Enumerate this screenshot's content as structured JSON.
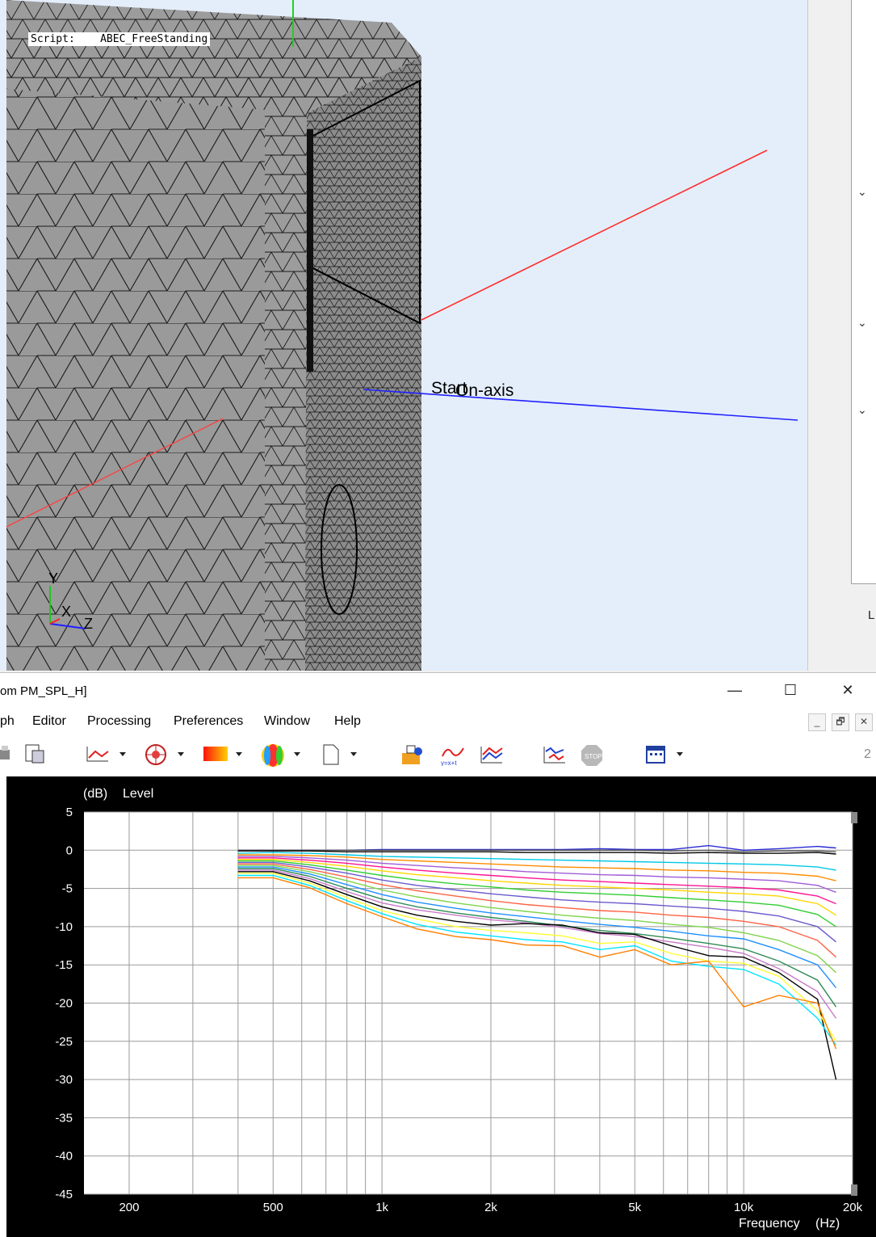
{
  "viewport": {
    "script_label": "Script:    ABEC_FreeStanding",
    "observation_label": "Start",
    "observation_label_overlap": "On-axis",
    "axis_y": "Y",
    "axis_x": "X",
    "axis_z": "Z"
  },
  "side_panel": {
    "letter": "L"
  },
  "window": {
    "title": "om PM_SPL_H]",
    "minimize": "—",
    "maximize": "☐",
    "close": "✕"
  },
  "menu": [
    "ph",
    "Editor",
    "Processing",
    "Preferences",
    "Window",
    "Help"
  ],
  "mdi_buttons": [
    "_",
    "🗗",
    "✕"
  ],
  "toolbar_right_label": "2",
  "toolbar": {
    "icons": [
      "print-icon",
      "paste-icon",
      "line-chart-icon",
      "polar-chart-icon",
      "color-map-icon",
      "balloon-icon",
      "new-page-icon",
      "open-folder-icon",
      "function-icon",
      "graph-icon",
      "graph-stack-icon",
      "stop-icon",
      "calendar-icon"
    ]
  },
  "chart_data": {
    "type": "line",
    "ylabel": "Level",
    "yunit": "(dB)",
    "xlabel": "Frequency",
    "xunit": "(Hz)",
    "xscale": "log",
    "xlim": [
      150,
      20000
    ],
    "ylim": [
      -45,
      5
    ],
    "x_ticks": [
      "200",
      "500",
      "1k",
      "2k",
      "5k",
      "10k",
      "20k"
    ],
    "y_ticks": [
      "5",
      "0",
      "-5",
      "-10",
      "-15",
      "-20",
      "-25",
      "-30",
      "-35",
      "-40",
      "-45"
    ],
    "grid": true,
    "x": [
      400,
      500,
      630,
      800,
      1000,
      1250,
      1600,
      2000,
      2500,
      3150,
      4000,
      5000,
      6300,
      8000,
      10000,
      12500,
      16000,
      18000
    ],
    "series": [
      {
        "color": "#2b2bd6",
        "values": [
          0.0,
          0.0,
          0.0,
          0.0,
          0.1,
          0.1,
          0.1,
          0.1,
          0.1,
          0.1,
          0.2,
          0.1,
          0.1,
          0.6,
          0.0,
          0.2,
          0.5,
          0.3
        ]
      },
      {
        "color": "#555555",
        "values": [
          0.0,
          0.0,
          0.0,
          0.0,
          0.0,
          0.0,
          0.0,
          0.0,
          0.0,
          0.0,
          0.0,
          0.0,
          -0.1,
          0.0,
          -0.2,
          -0.1,
          -0.1,
          -0.2
        ]
      },
      {
        "color": "#000000",
        "values": [
          -0.1,
          -0.1,
          -0.1,
          -0.2,
          -0.2,
          -0.2,
          -0.2,
          -0.2,
          -0.3,
          -0.3,
          -0.3,
          -0.3,
          -0.4,
          -0.3,
          -0.4,
          -0.4,
          -0.3,
          -0.5
        ]
      },
      {
        "color": "#00c8e6",
        "values": [
          -0.4,
          -0.3,
          -0.4,
          -0.6,
          -0.8,
          -0.9,
          -1.0,
          -1.1,
          -1.2,
          -1.3,
          -1.4,
          -1.5,
          -1.6,
          -1.7,
          -1.8,
          -1.9,
          -2.2,
          -2.6
        ]
      },
      {
        "color": "#ff8c00",
        "values": [
          -0.6,
          -0.6,
          -0.7,
          -0.9,
          -1.2,
          -1.4,
          -1.6,
          -1.8,
          -2.0,
          -2.2,
          -2.3,
          -2.4,
          -2.6,
          -2.7,
          -2.9,
          -3.0,
          -3.4,
          -4.0
        ]
      },
      {
        "color": "#a05cd6",
        "values": [
          -0.8,
          -0.8,
          -1.0,
          -1.3,
          -1.7,
          -2.0,
          -2.3,
          -2.5,
          -2.8,
          -3.0,
          -3.2,
          -3.3,
          -3.5,
          -3.6,
          -3.8,
          -4.0,
          -4.6,
          -5.5
        ]
      },
      {
        "color": "#ff1493",
        "values": [
          -1.0,
          -1.0,
          -1.3,
          -1.7,
          -2.2,
          -2.6,
          -3.0,
          -3.3,
          -3.6,
          -3.9,
          -4.1,
          -4.3,
          -4.5,
          -4.7,
          -4.9,
          -5.2,
          -6.0,
          -7.0
        ]
      },
      {
        "color": "#ffd700",
        "values": [
          -1.2,
          -1.2,
          -1.6,
          -2.1,
          -2.7,
          -3.2,
          -3.6,
          -4.0,
          -4.3,
          -4.6,
          -4.8,
          -5.0,
          -5.2,
          -5.5,
          -5.7,
          -6.0,
          -7.0,
          -8.5
        ]
      },
      {
        "color": "#32cd32",
        "values": [
          -1.4,
          -1.4,
          -1.9,
          -2.6,
          -3.3,
          -3.9,
          -4.4,
          -4.8,
          -5.2,
          -5.5,
          -5.7,
          -5.9,
          -6.2,
          -6.5,
          -6.8,
          -7.2,
          -8.4,
          -10.0
        ]
      },
      {
        "color": "#6a5acd",
        "values": [
          -1.6,
          -1.6,
          -2.2,
          -3.0,
          -3.9,
          -4.6,
          -5.2,
          -5.7,
          -6.1,
          -6.5,
          -6.8,
          -7.0,
          -7.3,
          -7.6,
          -8.0,
          -8.6,
          -10.0,
          -12.0
        ]
      },
      {
        "color": "#ff6347",
        "values": [
          -1.8,
          -1.8,
          -2.5,
          -3.5,
          -4.5,
          -5.3,
          -6.0,
          -6.6,
          -7.1,
          -7.5,
          -7.9,
          -8.1,
          -8.5,
          -8.8,
          -9.3,
          -10.0,
          -11.8,
          -14.0
        ]
      },
      {
        "color": "#7fd44a",
        "values": [
          -2.0,
          -2.0,
          -2.8,
          -4.0,
          -5.2,
          -6.1,
          -6.9,
          -7.5,
          -8.0,
          -8.5,
          -8.9,
          -9.2,
          -9.7,
          -10.1,
          -10.8,
          -11.8,
          -13.8,
          -16.0
        ]
      },
      {
        "color": "#1e90ff",
        "values": [
          -2.2,
          -2.2,
          -3.1,
          -4.5,
          -5.8,
          -6.8,
          -7.6,
          -8.2,
          -8.7,
          -9.2,
          -9.7,
          -10.1,
          -10.6,
          -11.2,
          -11.6,
          -13.0,
          -15.0,
          -18.0
        ]
      },
      {
        "color": "#2e8b57",
        "values": [
          -2.4,
          -2.4,
          -3.4,
          -5.0,
          -6.4,
          -7.4,
          -8.2,
          -8.8,
          -9.3,
          -9.9,
          -10.5,
          -10.9,
          -11.5,
          -12.2,
          -12.9,
          -14.5,
          -17.0,
          -20.5
        ]
      },
      {
        "color": "#c87ac8",
        "values": [
          -2.6,
          -2.6,
          -3.7,
          -5.4,
          -6.9,
          -7.8,
          -8.5,
          -9.1,
          -9.5,
          -10.1,
          -10.9,
          -11.3,
          -12.0,
          -12.7,
          -13.5,
          -15.5,
          -18.5,
          -22.0
        ]
      },
      {
        "color": "#000000",
        "values": [
          -2.8,
          -2.8,
          -4.0,
          -5.8,
          -7.4,
          -8.5,
          -9.3,
          -9.8,
          -9.6,
          -9.8,
          -10.8,
          -11.0,
          -12.5,
          -13.8,
          -14.0,
          -16.0,
          -19.5,
          -30.0
        ]
      },
      {
        "color": "#ffff33",
        "values": [
          -3.0,
          -3.0,
          -4.3,
          -6.2,
          -7.9,
          -9.0,
          -10.0,
          -10.5,
          -10.8,
          -11.2,
          -12.2,
          -12.0,
          -13.5,
          -14.5,
          -14.8,
          -16.5,
          -21.0,
          -25.0
        ]
      },
      {
        "color": "#00e5ff",
        "values": [
          -3.3,
          -3.3,
          -4.6,
          -6.6,
          -8.3,
          -9.7,
          -10.7,
          -11.2,
          -11.7,
          -12.0,
          -13.0,
          -12.5,
          -14.5,
          -15.2,
          -15.6,
          -17.5,
          -22.0,
          -25.5
        ]
      },
      {
        "color": "#ff7f00",
        "values": [
          -3.6,
          -3.6,
          -4.9,
          -7.0,
          -8.7,
          -10.3,
          -11.3,
          -11.7,
          -12.4,
          -12.5,
          -14.0,
          -13.0,
          -15.0,
          -14.5,
          -20.5,
          -19.0,
          -20.0,
          -26.0
        ]
      }
    ]
  }
}
